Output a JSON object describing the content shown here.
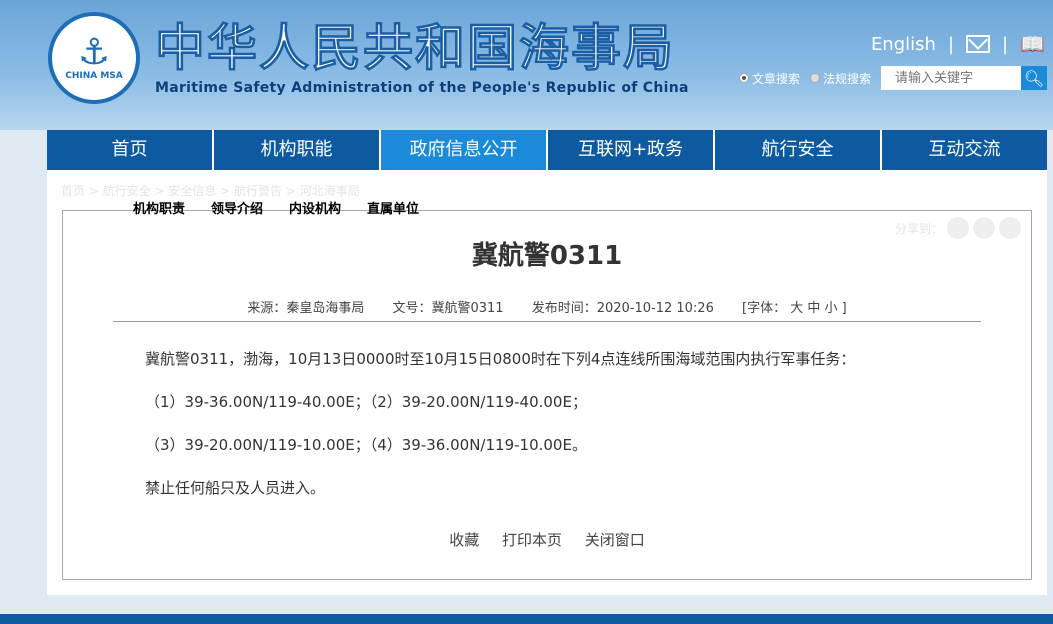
{
  "header": {
    "logo_text": "CHINA MSA",
    "title_cn": "中华人民共和国海事局",
    "title_en": "Maritime Safety Administration of the People's Republic of China",
    "english": "English",
    "sep": "|"
  },
  "search": {
    "opt1": "文章搜索",
    "opt2": "法规搜索",
    "placeholder": "请输入关键字"
  },
  "nav": [
    "首页",
    "机构职能",
    "政府信息公开",
    "互联网+政务",
    "航行安全",
    "互动交流"
  ],
  "breadcrumb": "首页 > 航行安全 > 安全信息 > 航行警告 > 河北海事局",
  "subnav": [
    "机构职责",
    "领导介绍",
    "内设机构",
    "直属单位"
  ],
  "share": "分享到：",
  "article": {
    "title": "冀航警0311",
    "source": "来源：秦皇岛海事局",
    "docno": "文号：冀航警0311",
    "time": "发布时间：2020-10-12 10:26",
    "font": "[字体： 大  中  小 ]",
    "paras": [
      "冀航警0311，渤海，10月13日0000时至10月15日0800时在下列4点连线所围海域范围内执行军事任务：",
      "（1）39-36.00N/119-40.00E；（2）39-20.00N/119-40.00E；",
      "（3）39-20.00N/119-10.00E；（4）39-36.00N/119-10.00E。",
      "禁止任何船只及人员进入。"
    ]
  },
  "actions": [
    "收藏",
    "打印本页",
    "关闭窗口"
  ]
}
